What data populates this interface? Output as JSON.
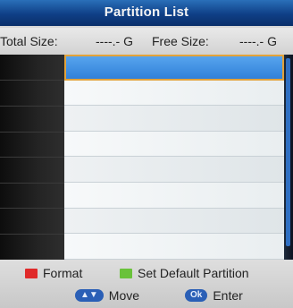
{
  "title": "Partition List",
  "size_info": {
    "total_label": "Total Size:",
    "total_value": "----.- G",
    "free_label": "Free Size:",
    "free_value": "----.- G"
  },
  "partition_rows": [
    "",
    "",
    "",
    "",
    "",
    "",
    "",
    ""
  ],
  "selected_row": 0,
  "footer": {
    "format": {
      "label": "Format",
      "color": "#e02a2a"
    },
    "set_default": {
      "label": "Set Default Partition",
      "color": "#69c23a"
    },
    "move": {
      "key_glyph": "▲▼",
      "label": "Move"
    },
    "enter": {
      "key_glyph": "Ok",
      "label": "Enter"
    }
  }
}
